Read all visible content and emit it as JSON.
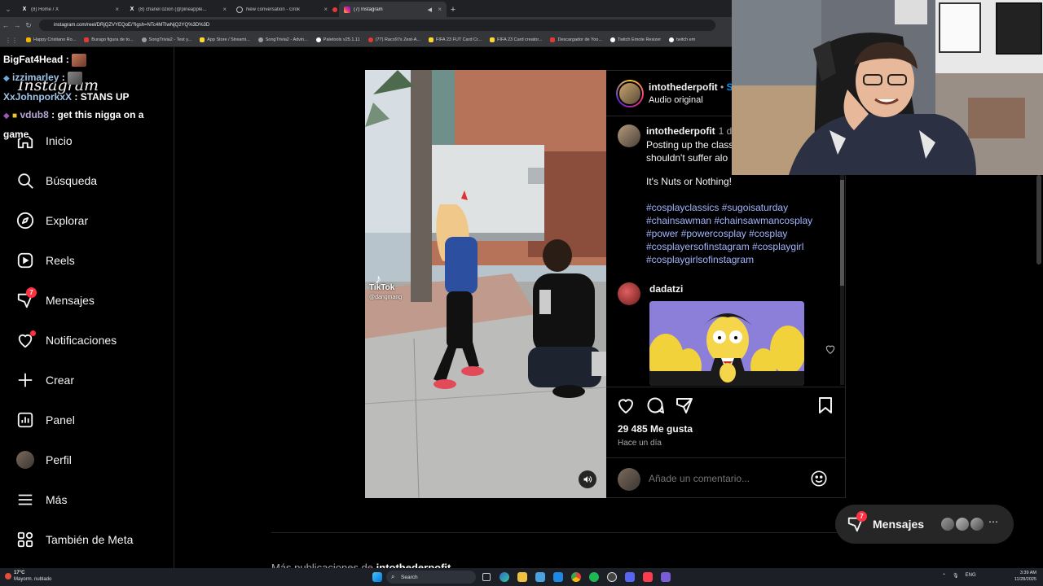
{
  "browser": {
    "tabs": [
      {
        "title": "(8) Home / X",
        "icon": "x-logo-icon",
        "active": false
      },
      {
        "title": "(8) chanel ozion (@pineapple...",
        "icon": "x-logo-icon",
        "active": false
      },
      {
        "title": "New conversation - Grok",
        "icon": "grok-icon",
        "active": false
      },
      {
        "title": "(7) Instagram",
        "icon": "instagram-icon",
        "active": true
      }
    ],
    "url": "instagram.com/reel/DRjQZVYEQoE/?igsh=NTc4MTIwNjQ2YQ%3D%3D",
    "bookmarks": [
      {
        "label": "Happy Cristiano Ro...",
        "color": "#f4b400"
      },
      {
        "label": "Burago figura de to...",
        "color": "#e53935"
      },
      {
        "label": "SongTrivia2 - Test y...",
        "color": "#9e9e9e"
      },
      {
        "label": "App Store / Streami...",
        "color": "#fdd835"
      },
      {
        "label": "SongTrivia2 - Advin...",
        "color": "#9e9e9e"
      },
      {
        "label": "Paletools v25.1.11",
        "color": "#ffffff"
      },
      {
        "label": "(77) Raco97s Zest-A...",
        "color": "#e53935"
      },
      {
        "label": "FIFA 23 FUT Card Cr...",
        "color": "#fdd835"
      },
      {
        "label": "FIFA 23 Card creator...",
        "color": "#fdd835"
      },
      {
        "label": "Descargador de Yoo...",
        "color": "#e53935"
      },
      {
        "label": "Twitch Emote Resizer",
        "color": "#ffffff"
      },
      {
        "label": "twitch em",
        "color": "#ffffff"
      }
    ]
  },
  "sidebar": {
    "logo": "Instagram",
    "items": [
      {
        "label": "Inicio",
        "icon": "home-icon"
      },
      {
        "label": "Búsqueda",
        "icon": "search-icon"
      },
      {
        "label": "Explorar",
        "icon": "compass-icon"
      },
      {
        "label": "Reels",
        "icon": "reels-icon"
      },
      {
        "label": "Mensajes",
        "icon": "messenger-icon",
        "badge": "7"
      },
      {
        "label": "Notificaciones",
        "icon": "heart-icon"
      },
      {
        "label": "Crear",
        "icon": "plus-icon"
      },
      {
        "label": "Panel",
        "icon": "dashboard-icon"
      },
      {
        "label": "Perfil",
        "icon": "profile-avatar"
      },
      {
        "label": "Más",
        "icon": "menu-icon"
      },
      {
        "label": "También de Meta",
        "icon": "meta-grid-icon"
      }
    ]
  },
  "chat": [
    {
      "user": "BigFat4Head",
      "sep": " :",
      "text": ""
    },
    {
      "user": "izzimarley",
      "sep": " :",
      "text": ""
    },
    {
      "user": "XxJohnporkxX",
      "sep": " :",
      "text": "STANS UP"
    },
    {
      "user": "vdub8",
      "sep": " :",
      "text": "get this nigga on a"
    },
    {
      "user": "",
      "sep": "",
      "text": "game"
    }
  ],
  "video": {
    "watermark_brand": "TikTok",
    "watermark_handle": "@dangmang",
    "mute_icon": "speaker-icon"
  },
  "post": {
    "username": "intothederpofit",
    "separator": " • ",
    "follow": "S",
    "audio": "Audio original",
    "caption_user": "intothederpofit",
    "caption_time": "1 d",
    "caption_line1": "Posting up the class",
    "caption_line2": "shouldn't suffer alo",
    "caption_line3": "It's Nuts or Nothing!",
    "hashtags": [
      "#cosplayclassics #sugoisaturday",
      "#chainsawman #chainsawmancosplay",
      "#power #powercosplay #cosplay",
      "#cosplayersofinstagram #cosplaygirl",
      "#cosplaygirlsofinstagram"
    ],
    "comment_user": "dadatzi",
    "likes": "29 485 Me gusta",
    "time": "Hace un día",
    "comment_placeholder": "Añade un comentario..."
  },
  "floating": {
    "label": "Mensajes",
    "badge": "7"
  },
  "more_from_prefix": "Más publicaciones de",
  "more_from_user": "intothederpofit",
  "taskbar": {
    "weather_temp": "17°C",
    "weather_desc": "Mayorm. nublado",
    "search": "Search",
    "lang": "ENG",
    "time": "3:39 AM",
    "date": "11/28/2025"
  },
  "colors": {
    "accent_blue": "#0095f6",
    "badge_red": "#ff3040",
    "hashtag": "#a3b5ff"
  }
}
